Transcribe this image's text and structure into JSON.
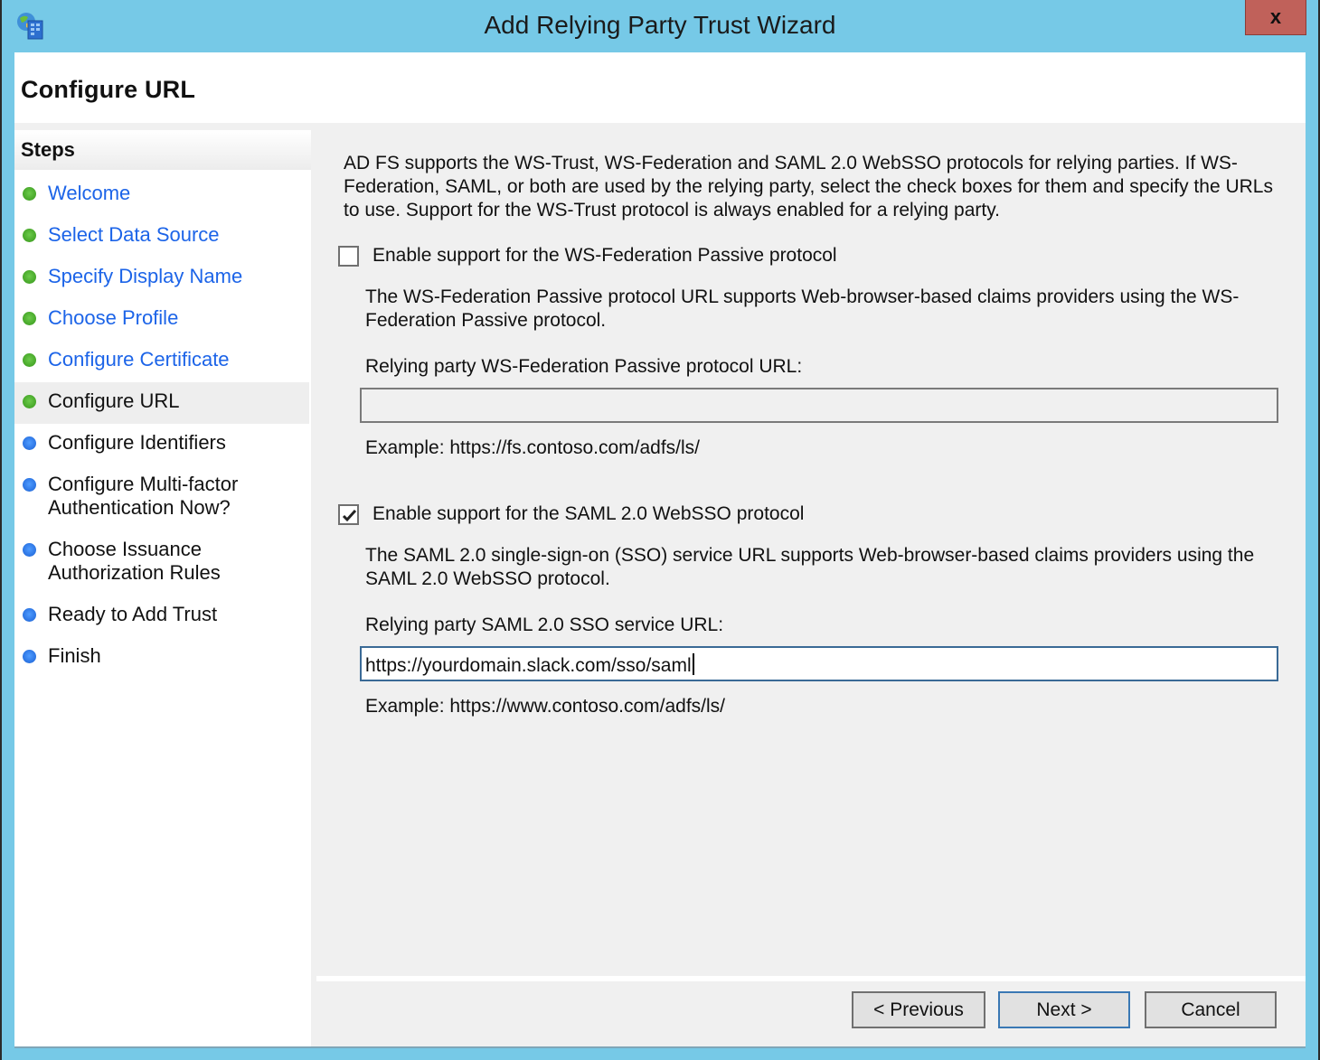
{
  "window": {
    "title": "Add Relying Party Trust Wizard",
    "app_icon": "adfs-globe-icon",
    "close_label": "x",
    "colors": {
      "frame": "#76c9e7",
      "close": "#c0615a",
      "link": "#1c64e8",
      "step_done": "#4bab2d",
      "step_todo": "#2f78e6"
    }
  },
  "header": {
    "title": "Configure URL"
  },
  "sidebar": {
    "title": "Steps",
    "items": [
      {
        "label": "Welcome",
        "status": "done",
        "link": true
      },
      {
        "label": "Select Data Source",
        "status": "done",
        "link": true
      },
      {
        "label": "Specify Display Name",
        "status": "done",
        "link": true
      },
      {
        "label": "Choose Profile",
        "status": "done",
        "link": true
      },
      {
        "label": "Configure Certificate",
        "status": "done",
        "link": true
      },
      {
        "label": "Configure URL",
        "status": "done",
        "link": false,
        "current": true
      },
      {
        "label": "Configure Identifiers",
        "status": "todo",
        "link": false
      },
      {
        "label": "Configure Multi-factor\nAuthentication Now?",
        "status": "todo",
        "link": false
      },
      {
        "label": "Choose Issuance\nAuthorization Rules",
        "status": "todo",
        "link": false
      },
      {
        "label": "Ready to Add Trust",
        "status": "todo",
        "link": false
      },
      {
        "label": "Finish",
        "status": "todo",
        "link": false
      }
    ]
  },
  "main": {
    "intro": "AD FS supports the WS-Trust, WS-Federation and SAML 2.0 WebSSO protocols for relying parties.  If WS-Federation, SAML, or both are used by the relying party, select the check boxes for them and specify the URLs to use.  Support for the WS-Trust protocol is always enabled for a relying party.",
    "wsfed": {
      "checkbox_label": "Enable support for the WS-Federation Passive protocol",
      "checked": false,
      "description": "The WS-Federation Passive protocol URL supports Web-browser-based claims providers using the WS-Federation Passive protocol.",
      "field_label": "Relying party WS-Federation Passive protocol URL:",
      "value": "",
      "example": "Example: https://fs.contoso.com/adfs/ls/"
    },
    "saml": {
      "checkbox_label": "Enable support for the SAML 2.0 WebSSO protocol",
      "checked": true,
      "description": "The SAML 2.0 single-sign-on (SSO) service URL supports Web-browser-based claims providers using the SAML 2.0 WebSSO protocol.",
      "field_label": "Relying party SAML 2.0 SSO service URL:",
      "value": "https://yourdomain.slack.com/sso/saml",
      "example": "Example: https://www.contoso.com/adfs/ls/"
    }
  },
  "footer": {
    "previous_label": "< Previous",
    "next_label": "Next >",
    "cancel_label": "Cancel"
  }
}
